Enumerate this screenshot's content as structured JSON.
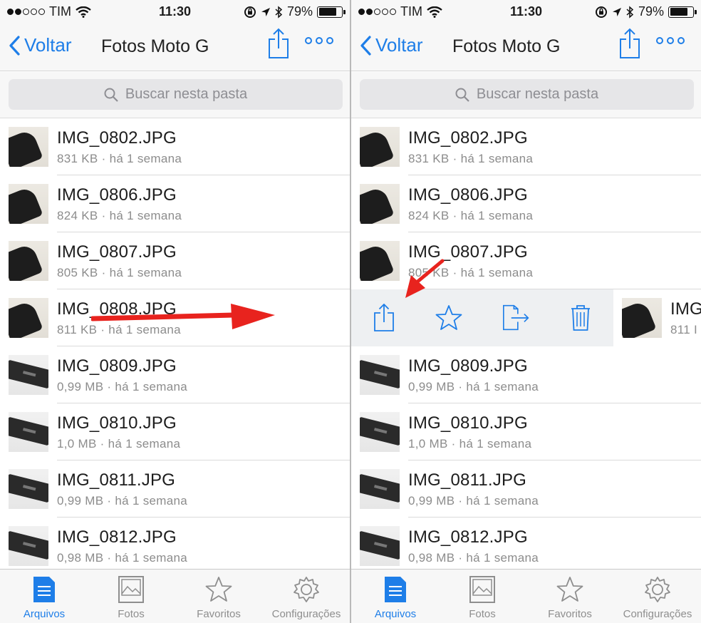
{
  "status": {
    "carrier": "TIM",
    "time": "11:30",
    "battery": "79%",
    "battery_level": 0.79
  },
  "nav": {
    "back_label": "Voltar",
    "title": "Fotos Moto G"
  },
  "search": {
    "placeholder": "Buscar nesta pasta"
  },
  "files": [
    {
      "name": "IMG_0802.JPG",
      "meta": "831 KB · há 1 semana",
      "thumb": "phone"
    },
    {
      "name": "IMG_0806.JPG",
      "meta": "824 KB · há 1 semana",
      "thumb": "phone"
    },
    {
      "name": "IMG_0807.JPG",
      "meta": "805 KB · há 1 semana",
      "thumb": "phone"
    },
    {
      "name": "IMG_0808.JPG",
      "meta": "811 KB · há 1 semana",
      "thumb": "phone"
    },
    {
      "name": "IMG_0809.JPG",
      "meta": "0,99 MB · há 1 semana",
      "thumb": "device"
    },
    {
      "name": "IMG_0810.JPG",
      "meta": "1,0 MB · há 1 semana",
      "thumb": "device"
    },
    {
      "name": "IMG_0811.JPG",
      "meta": "0,99 MB · há 1 semana",
      "thumb": "device"
    },
    {
      "name": "IMG_0812.JPG",
      "meta": "0,98 MB · há 1 semana",
      "thumb": "device"
    }
  ],
  "swiped": {
    "name_partial": "IMG",
    "meta_partial": "811 I",
    "actions": [
      "share-icon",
      "star-icon",
      "move-icon",
      "trash-icon"
    ]
  },
  "tabs": [
    {
      "label": "Arquivos",
      "icon": "document-icon",
      "active": true
    },
    {
      "label": "Fotos",
      "icon": "photo-icon",
      "active": false
    },
    {
      "label": "Favoritos",
      "icon": "star-icon",
      "active": false
    },
    {
      "label": "Configurações",
      "icon": "gear-icon",
      "active": false
    }
  ],
  "colors": {
    "accent": "#1e7ee8",
    "annotation": "#e8231e"
  }
}
